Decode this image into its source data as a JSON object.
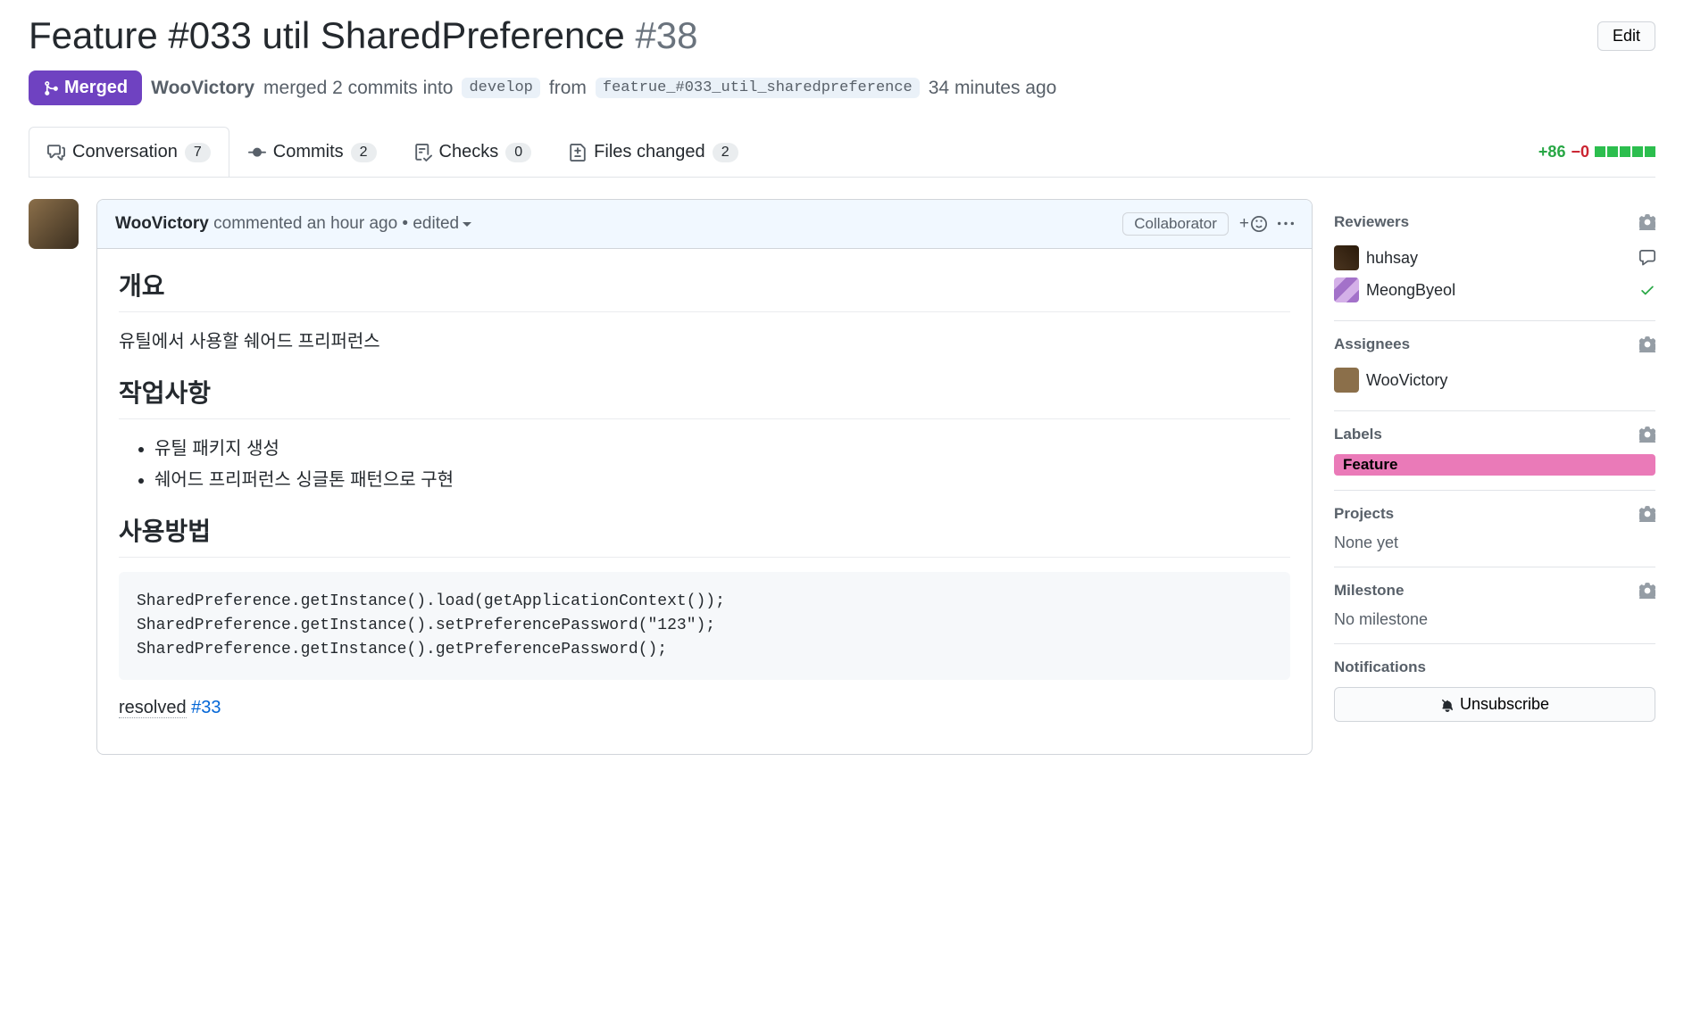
{
  "header": {
    "title": "Feature #033 util SharedPreference",
    "number": "#38",
    "edit_label": "Edit"
  },
  "state": {
    "badge": "Merged",
    "author": "WooVictory",
    "merged_text_1": "merged 2 commits into",
    "base_branch": "develop",
    "from_text": "from",
    "head_branch": "featrue_#033_util_sharedpreference",
    "time_ago": "34 minutes ago"
  },
  "tabs": {
    "conversation": {
      "label": "Conversation",
      "count": "7"
    },
    "commits": {
      "label": "Commits",
      "count": "2"
    },
    "checks": {
      "label": "Checks",
      "count": "0"
    },
    "files": {
      "label": "Files changed",
      "count": "2"
    }
  },
  "diff": {
    "additions": "+86",
    "deletions": "−0"
  },
  "comment": {
    "author": "WooVictory",
    "commented": "commented",
    "time": "an hour ago",
    "edited": "edited",
    "badge": "Collaborator",
    "h1": "개요",
    "p1": "유틸에서 사용할 쉐어드 프리퍼런스",
    "h2": "작업사항",
    "li1": "유틸 패키지 생성",
    "li2": "쉐어드 프리퍼런스 싱글톤 패턴으로 구현",
    "h3": "사용방법",
    "code": "SharedPreference.getInstance().load(getApplicationContext());\nSharedPreference.getInstance().setPreferencePassword(\"123\");\nSharedPreference.getInstance().getPreferencePassword();",
    "resolved": "resolved",
    "issue_ref": "#33"
  },
  "sidebar": {
    "reviewers": {
      "title": "Reviewers",
      "items": [
        {
          "name": "huhsay",
          "status": "comment"
        },
        {
          "name": "MeongByeol",
          "status": "approved"
        }
      ]
    },
    "assignees": {
      "title": "Assignees",
      "items": [
        {
          "name": "WooVictory"
        }
      ]
    },
    "labels": {
      "title": "Labels",
      "tag": "Feature"
    },
    "projects": {
      "title": "Projects",
      "value": "None yet"
    },
    "milestone": {
      "title": "Milestone",
      "value": "No milestone"
    },
    "notifications": {
      "title": "Notifications",
      "button": "Unsubscribe"
    }
  }
}
